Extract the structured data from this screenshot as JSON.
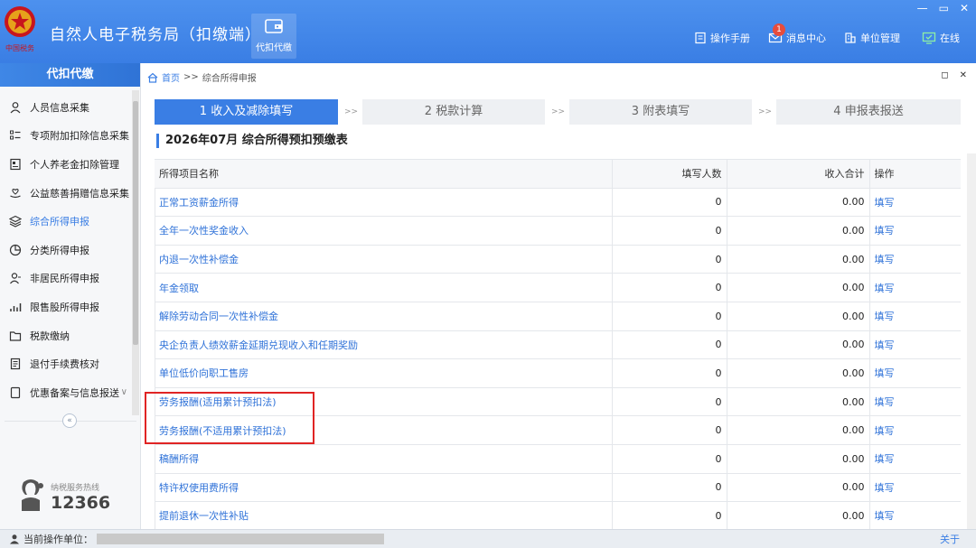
{
  "app": {
    "title": "自然人电子税务局（扣缴端）",
    "logo_text": "中国税务",
    "nav_tile_label": "代扣代缴",
    "window_controls": [
      "—",
      "▭",
      "✕"
    ]
  },
  "toolbar": {
    "manual": "操作手册",
    "messages": "消息中心",
    "messages_badge": "1",
    "unit_mgmt": "单位管理",
    "online": "在线"
  },
  "sidebar": {
    "title": "代扣代缴",
    "items": [
      {
        "label": "人员信息采集",
        "icon": "person-icon"
      },
      {
        "label": "专项附加扣除信息采集",
        "icon": "list-icon"
      },
      {
        "label": "个人养老金扣除管理",
        "icon": "card-icon"
      },
      {
        "label": "公益慈善捐赠信息采集",
        "icon": "heart-hand-icon"
      },
      {
        "label": "综合所得申报",
        "icon": "layers-icon",
        "active": true
      },
      {
        "label": "分类所得申报",
        "icon": "pie-icon"
      },
      {
        "label": "非居民所得申报",
        "icon": "user-outline-icon"
      },
      {
        "label": "限售股所得申报",
        "icon": "bar-chart-icon"
      },
      {
        "label": "税款缴纳",
        "icon": "folder-icon"
      },
      {
        "label": "退付手续费核对",
        "icon": "document-icon"
      },
      {
        "label": "优惠备案与信息报送",
        "icon": "file-icon",
        "has_caret": true
      }
    ],
    "collapse_symbol": "«",
    "hotline_label": "纳税服务热线",
    "hotline_number": "12366"
  },
  "breadcrumb": {
    "home": "首页",
    "separator": ">>",
    "current": "综合所得申报"
  },
  "steps": [
    {
      "label": "1 收入及减除填写",
      "active": true
    },
    {
      "label": "2 税款计算"
    },
    {
      "label": "3 附表填写"
    },
    {
      "label": "4 申报表报送"
    }
  ],
  "step_separator": ">>",
  "page_title": "2026年07月  综合所得预扣预缴表",
  "table": {
    "headers": [
      "所得项目名称",
      "填写人数",
      "收入合计",
      "操作"
    ],
    "rows": [
      {
        "name": "正常工资薪金所得",
        "count": "0",
        "total": "0.00",
        "action": "填写"
      },
      {
        "name": "全年一次性奖金收入",
        "count": "0",
        "total": "0.00",
        "action": "填写"
      },
      {
        "name": "内退一次性补偿金",
        "count": "0",
        "total": "0.00",
        "action": "填写"
      },
      {
        "name": "年金领取",
        "count": "0",
        "total": "0.00",
        "action": "填写"
      },
      {
        "name": "解除劳动合同一次性补偿金",
        "count": "0",
        "total": "0.00",
        "action": "填写"
      },
      {
        "name": "央企负责人绩效薪金延期兑现收入和任期奖励",
        "count": "0",
        "total": "0.00",
        "action": "填写"
      },
      {
        "name": "单位低价向职工售房",
        "count": "0",
        "total": "0.00",
        "action": "填写"
      },
      {
        "name": "劳务报酬(适用累计预扣法)",
        "count": "0",
        "total": "0.00",
        "action": "填写"
      },
      {
        "name": "劳务报酬(不适用累计预扣法)",
        "count": "0",
        "total": "0.00",
        "action": "填写"
      },
      {
        "name": "稿酬所得",
        "count": "0",
        "total": "0.00",
        "action": "填写"
      },
      {
        "name": "特许权使用费所得",
        "count": "0",
        "total": "0.00",
        "action": "填写"
      },
      {
        "name": "提前退休一次性补贴",
        "count": "0",
        "total": "0.00",
        "action": "填写"
      }
    ]
  },
  "statusbar": {
    "unit_label": "当前操作单位：",
    "about": "关于"
  },
  "colors": {
    "brand_blue": "#3a7ee4",
    "highlight_red": "#e02424",
    "badge_red": "#e74c3c"
  }
}
